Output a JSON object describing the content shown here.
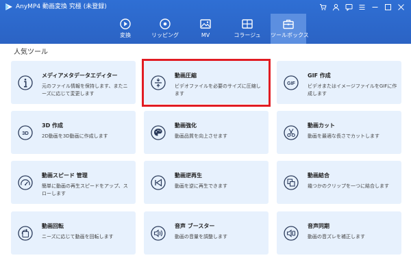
{
  "app": {
    "title": "AnyMP4 動画変換 究極 (未登録)"
  },
  "tabs": [
    {
      "label": "変換",
      "icon": "convert-icon"
    },
    {
      "label": "リッピング",
      "icon": "ripping-icon"
    },
    {
      "label": "MV",
      "icon": "mv-icon"
    },
    {
      "label": "コラージュ",
      "icon": "collage-icon"
    },
    {
      "label": "ツールボックス",
      "icon": "toolbox-icon",
      "active": true
    }
  ],
  "section": {
    "title": "人気ツール"
  },
  "tools": [
    {
      "title": "メディアメタデータエディター",
      "desc": "元のファイル情報を保持します、またニーズに応じて変更します",
      "icon": "info-icon"
    },
    {
      "title": "動画圧縮",
      "desc": "ビデオファイルを必要のサイズに圧縮します",
      "icon": "compress-icon"
    },
    {
      "title": "GIF 作成",
      "desc": "ビデオまたはイメージファイルをGIFに作成します",
      "icon": "gif-icon"
    },
    {
      "title": "3D 作成",
      "desc": "2D動画を3D動画に作成します",
      "icon": "3d-icon"
    },
    {
      "title": "動画強化",
      "desc": "動画品質を向上させます",
      "icon": "palette-icon"
    },
    {
      "title": "動画カット",
      "desc": "動画を最適な長さでカットします",
      "icon": "scissors-icon"
    },
    {
      "title": "動画スピード 管理",
      "desc": "簡単に動画の再生スピードをアップ、スローします",
      "icon": "speedometer-icon"
    },
    {
      "title": "動画逆再生",
      "desc": "動画を逆に再生できます",
      "icon": "rewind-icon"
    },
    {
      "title": "動画結合",
      "desc": "幾つかのクリップを一つに結合します",
      "icon": "merge-icon"
    },
    {
      "title": "動画回転",
      "desc": "ニーズに応じて動画を回転します",
      "icon": "rotate-icon"
    },
    {
      "title": "音声 ブースター",
      "desc": "動画の音量を調整します",
      "icon": "volume-booster-icon"
    },
    {
      "title": "音声同期",
      "desc": "動画の音ズレを補正します",
      "icon": "audio-sync-icon"
    }
  ],
  "colors": {
    "header": "#2b63c4",
    "card": "#e7f1fd",
    "highlight": "#e11b22",
    "active_tab": "#5c8fe0"
  }
}
